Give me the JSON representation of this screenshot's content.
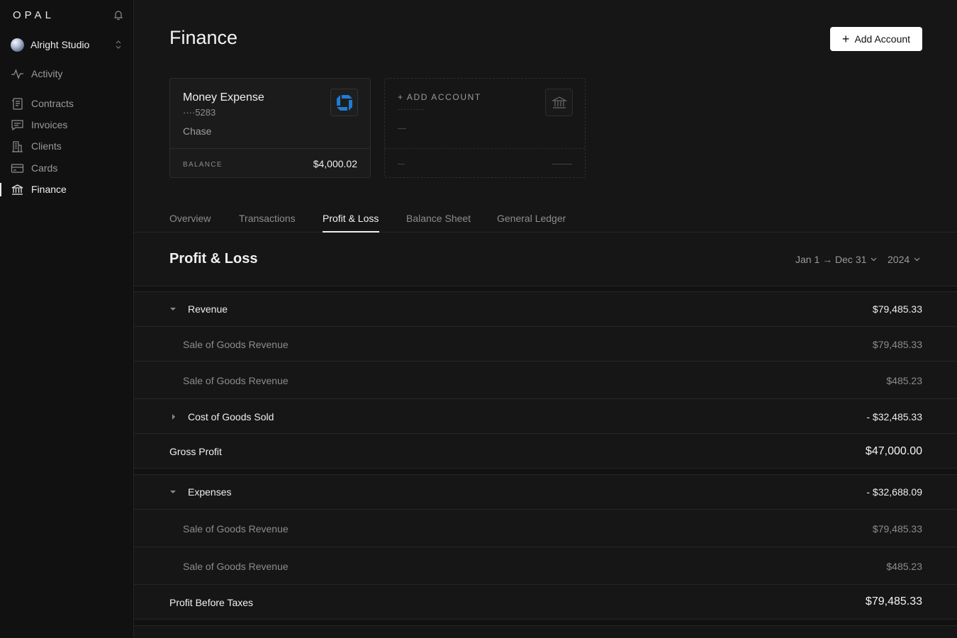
{
  "app": {
    "logo": "OPAL"
  },
  "workspace": {
    "name": "Alright Studio"
  },
  "nav": {
    "activity": "Activity",
    "contracts": "Contracts",
    "invoices": "Invoices",
    "clients": "Clients",
    "cards": "Cards",
    "finance": "Finance"
  },
  "page": {
    "title": "Finance",
    "add_button": "Add Account"
  },
  "accounts": [
    {
      "name": "Money Expense",
      "number": "····5283",
      "bank": "Chase",
      "balance_label": "BALANCE",
      "balance": "$4,000.02"
    }
  ],
  "placeholder_card": {
    "label": "+ ADD ACCOUNT",
    "dots": "·········"
  },
  "tabs": [
    "Overview",
    "Transactions",
    "Profit & Loss",
    "Balance Sheet",
    "General Ledger"
  ],
  "active_tab": "Profit & Loss",
  "pnl": {
    "title": "Profit & Loss",
    "date_range": "Jan 1 → Dec 31",
    "year": "2024",
    "revenue": {
      "label": "Revenue",
      "amount": "$79,485.33"
    },
    "revenue_items": [
      {
        "label": "Sale of Goods Revenue",
        "amount": "$79,485.33"
      },
      {
        "label": "Sale of Goods Revenue",
        "amount": "$485.23"
      }
    ],
    "cogs": {
      "label": "Cost of Goods Sold",
      "amount": "- $32,485.33"
    },
    "gross_profit": {
      "label": "Gross Profit",
      "amount": "$47,000.00"
    },
    "expenses": {
      "label": "Expenses",
      "amount": "- $32,688.09"
    },
    "expense_items": [
      {
        "label": "Sale of Goods Revenue",
        "amount": "$79,485.33"
      },
      {
        "label": "Sale of Goods Revenue",
        "amount": "$485.23"
      }
    ],
    "profit_before_taxes": {
      "label": "Profit Before Taxes",
      "amount": "$79,485.33"
    }
  },
  "colors": {
    "background": "#161616",
    "sidebar": "#111111",
    "chase_blue": "#1f7cd6"
  }
}
